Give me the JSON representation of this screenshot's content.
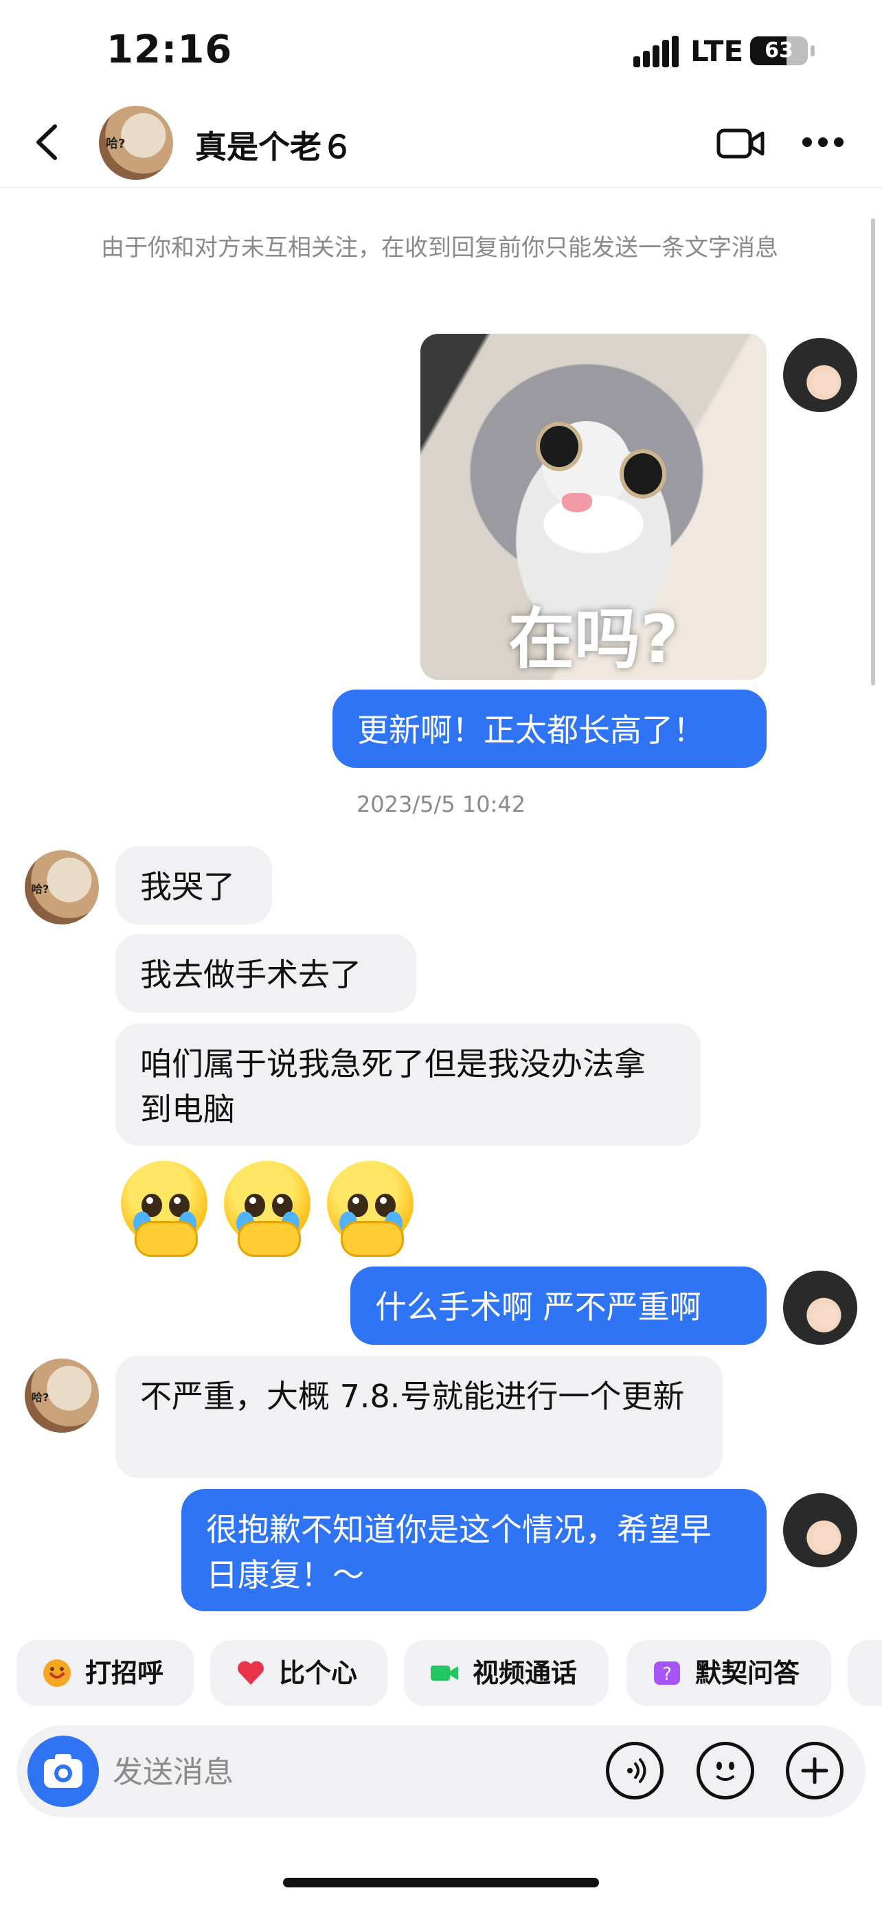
{
  "status_bar": {
    "time": "12:16",
    "network": "LTE",
    "battery_level": "63",
    "battery_fraction": 0.63
  },
  "header": {
    "contact_name": "真是个老６",
    "avatar_tag": "哈?"
  },
  "notice": "由于你和对方未互相关注，在收到回复前你只能发送一条文字消息",
  "messages": {
    "sticker_caption": "在吗?",
    "out1": "更新啊！正太都长高了！",
    "timestamp": "2023/5/5 10:42",
    "in1": "我哭了",
    "in2": "我去做手术去了",
    "in3": "咱们属于说我急死了但是我没办法拿到电脑",
    "emoji_icons": [
      "pleading-face-icon",
      "pleading-face-icon",
      "pleading-face-icon"
    ],
    "out2": "什么手术啊 严不严重啊",
    "in4": "不严重，大概 7.8.号就能进行一个更新",
    "out3": "很抱歉不知道你是这个情况，希望早日康复！～"
  },
  "quick_actions": [
    {
      "label": "打招呼",
      "icon": "wave-hand-icon",
      "color": "#f5a623"
    },
    {
      "label": "比个心",
      "icon": "heart-icon",
      "color": "#e8334a"
    },
    {
      "label": "视频通话",
      "icon": "video-camera-icon",
      "color": "#22c55e"
    },
    {
      "label": "默契问答",
      "icon": "question-icon",
      "color": "#a855f7"
    }
  ],
  "composer": {
    "placeholder": "发送消息"
  },
  "colors": {
    "accent": "#2f74f5",
    "incoming_bubble": "#f1f1f3",
    "muted_text": "#8a8a8a"
  }
}
